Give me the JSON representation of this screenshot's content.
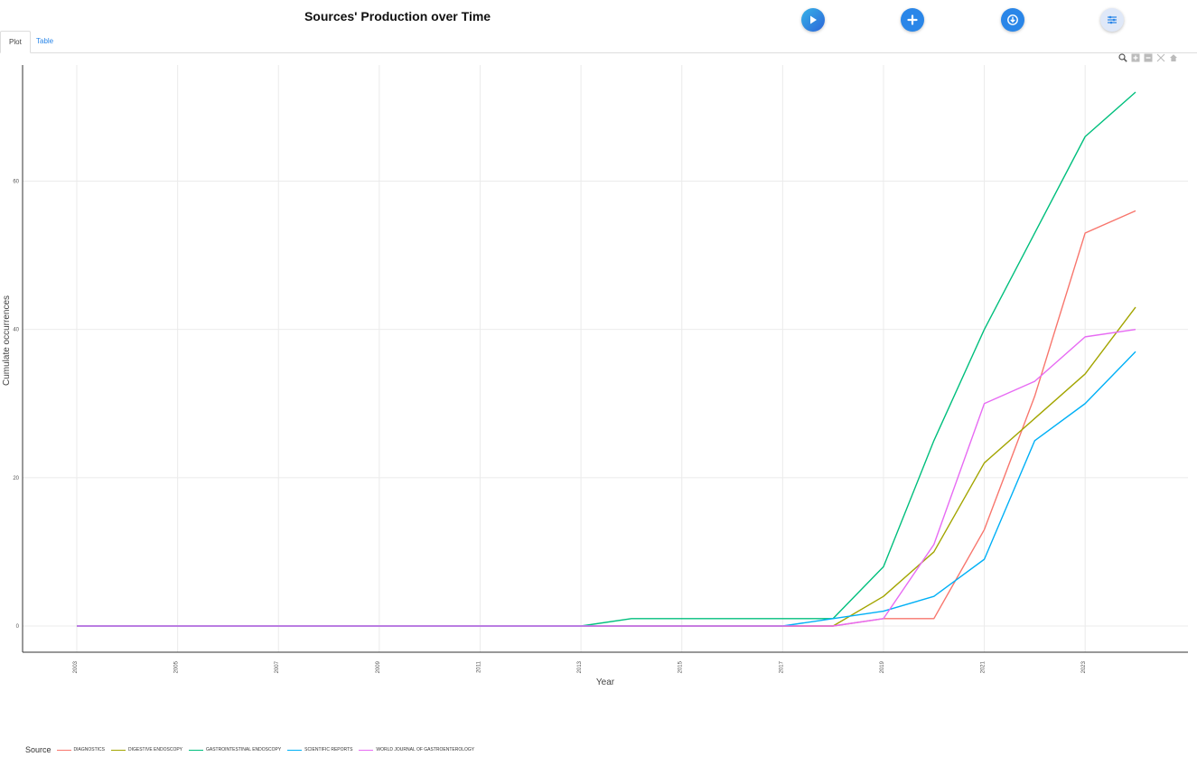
{
  "page": {
    "title": "Sources' Production over Time"
  },
  "toolbar": {
    "run_icon": "play-icon",
    "add_icon": "plus-icon",
    "export_icon": "download-icon",
    "options_icon": "sliders-icon"
  },
  "tabs": [
    {
      "label": "Plot",
      "active": true
    },
    {
      "label": "Table",
      "active": false
    }
  ],
  "modebar": {
    "icons": [
      "zoom-icon",
      "zoom-in-icon",
      "zoom-out-icon",
      "autoscale-icon",
      "home-icon"
    ]
  },
  "colors": {
    "DIAGNOSTICS": "#f8766d",
    "DIGESTIVE ENDOSCOPY": "#a3a500",
    "GASTROINTESTINAL ENDOSCOPY": "#00bf7d",
    "SCIENTIFIC REPORTS": "#00b0f6",
    "WORLD JOURNAL OF GASTROENTEROLOGY": "#e76bf3"
  },
  "chart_data": {
    "type": "line",
    "title": "",
    "xlabel": "Year",
    "ylabel": "Cumulate occurrences",
    "xlim": [
      2003,
      2024
    ],
    "ylim": [
      0,
      72
    ],
    "x_ticks": [
      "2003",
      "2005",
      "2007",
      "2009",
      "2011",
      "2013",
      "2015",
      "2017",
      "2019",
      "2021",
      "2023"
    ],
    "y_ticks": [
      "0",
      "20",
      "40",
      "60"
    ],
    "grid": true,
    "legend_title": "Source",
    "legend_position": "bottom",
    "x": [
      2003,
      2004,
      2005,
      2006,
      2007,
      2008,
      2009,
      2010,
      2011,
      2012,
      2013,
      2014,
      2015,
      2016,
      2017,
      2018,
      2019,
      2020,
      2021,
      2022,
      2023,
      2024
    ],
    "series": [
      {
        "name": "DIAGNOSTICS",
        "values": [
          0,
          0,
          0,
          0,
          0,
          0,
          0,
          0,
          0,
          0,
          0,
          0,
          0,
          0,
          0,
          0,
          1,
          1,
          13,
          31,
          53,
          56
        ]
      },
      {
        "name": "DIGESTIVE ENDOSCOPY",
        "values": [
          0,
          0,
          0,
          0,
          0,
          0,
          0,
          0,
          0,
          0,
          0,
          0,
          0,
          0,
          0,
          0,
          4,
          10,
          22,
          28,
          34,
          43
        ]
      },
      {
        "name": "GASTROINTESTINAL ENDOSCOPY",
        "values": [
          0,
          0,
          0,
          0,
          0,
          0,
          0,
          0,
          0,
          0,
          0,
          1,
          1,
          1,
          1,
          1,
          8,
          25,
          40,
          53,
          66,
          72
        ]
      },
      {
        "name": "SCIENTIFIC REPORTS",
        "values": [
          0,
          0,
          0,
          0,
          0,
          0,
          0,
          0,
          0,
          0,
          0,
          0,
          0,
          0,
          0,
          1,
          2,
          4,
          9,
          25,
          30,
          37
        ]
      },
      {
        "name": "WORLD JOURNAL OF GASTROENTEROLOGY",
        "values": [
          0,
          0,
          0,
          0,
          0,
          0,
          0,
          0,
          0,
          0,
          0,
          0,
          0,
          0,
          0,
          0,
          1,
          11,
          30,
          33,
          39,
          40
        ]
      }
    ]
  }
}
